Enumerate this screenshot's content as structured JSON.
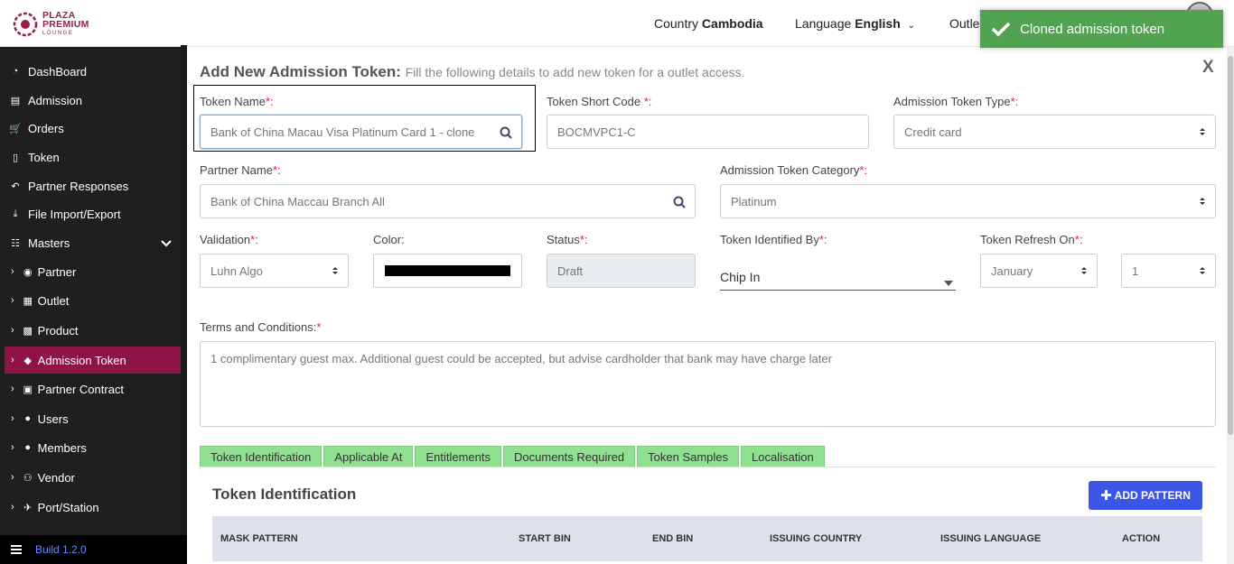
{
  "header": {
    "logo_line1": "PLAZA",
    "logo_line2": "PREMIUM",
    "logo_line3": "LOUNGE",
    "country_label": "Country",
    "country_value": "Cambodia",
    "language_label": "Language",
    "language_value": "English",
    "outlet_label": "Outle",
    "toast": "Cloned admission token"
  },
  "sidebar": {
    "items": [
      {
        "label": "DashBoard",
        "icon": "dashboard-icon"
      },
      {
        "label": "Admission",
        "icon": "id-card-icon"
      },
      {
        "label": "Orders",
        "icon": "cart-icon"
      },
      {
        "label": "Token",
        "icon": "file-icon"
      },
      {
        "label": "Partner Responses",
        "icon": "reply-icon"
      },
      {
        "label": "File Import/Export",
        "icon": "download-icon"
      },
      {
        "label": "Masters",
        "icon": "sitemap-icon"
      },
      {
        "label": "Partner",
        "icon": "eye-icon"
      },
      {
        "label": "Outlet",
        "icon": "building-icon"
      },
      {
        "label": "Product",
        "icon": "gift-icon"
      },
      {
        "label": "Admission Token",
        "icon": "tag-icon"
      },
      {
        "label": "Partner Contract",
        "icon": "briefcase-icon"
      },
      {
        "label": "Users",
        "icon": "user-icon"
      },
      {
        "label": "Members",
        "icon": "users-icon"
      },
      {
        "label": "Vendor",
        "icon": "male-icon"
      },
      {
        "label": "Port/Station",
        "icon": "plane-icon"
      }
    ],
    "build": "Build 1.2.0"
  },
  "form": {
    "title": "Add New Admission Token:",
    "subtitle": "Fill the following details to add new token for a outlet access.",
    "close": "X",
    "token_name_label": "Token Name",
    "token_name_value": "Bank of China Macau Visa Platinum Card 1 - clone",
    "short_code_label": "Token Short Code ",
    "short_code_value": "BOCMVPC1-C",
    "token_type_label": "Admission Token Type",
    "token_type_value": "Credit card",
    "partner_label": "Partner Name",
    "partner_value": "Bank of China Maccau Branch All",
    "category_label": "Admission Token Category",
    "category_value": "Platinum",
    "validation_label": "Validation",
    "validation_value": "Luhn Algo",
    "color_label": "Color:",
    "color_value": "#000000",
    "status_label": "Status",
    "status_value": "Draft",
    "identified_label": "Token Identified By",
    "identified_value": "Chip In",
    "refresh_label": "Token Refresh On",
    "refresh_month": "January",
    "refresh_day": "1",
    "terms_label": "Terms and Conditions:",
    "terms_value": "1 complimentary guest max. Additional guest could be accepted, but advise cardholder that bank may have charge later",
    "required": "*",
    "required_colon": "*:"
  },
  "tabs": [
    "Token Identification",
    "Applicable At",
    "Entitlements",
    "Documents Required",
    "Token Samples",
    "Localisation"
  ],
  "section": {
    "title": "Token Identification",
    "add_button": "ADD PATTERN",
    "columns": [
      "MASK PATTERN",
      "START BIN",
      "END BIN",
      "ISSUING COUNTRY",
      "ISSUING LANGUAGE",
      "ACTION"
    ]
  },
  "colors": {
    "accent": "#8e1446",
    "toast": "#51a351",
    "tab": "#8fe08f",
    "button": "#3b55e6"
  }
}
